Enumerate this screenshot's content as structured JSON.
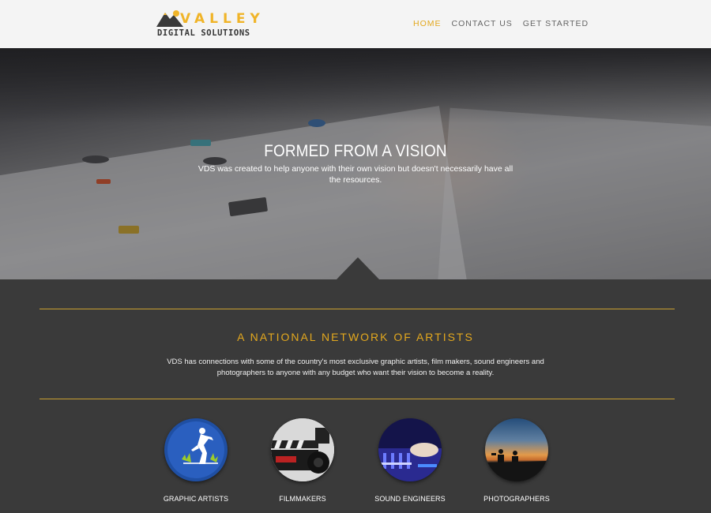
{
  "logo": {
    "top": "VALLEY",
    "bottom": "DIGITAL SOLUTIONS"
  },
  "nav": [
    {
      "label": "HOME",
      "active": true
    },
    {
      "label": "CONTACT US",
      "active": false
    },
    {
      "label": "GET STARTED",
      "active": false
    }
  ],
  "hero": {
    "title": "FORMED FROM A VISION",
    "subtitle": "VDS was created to help anyone with their own vision but doesn't necessarily have all the resources."
  },
  "network": {
    "title": "A NATIONAL NETWORK OF ARTISTS",
    "text": "VDS has connections with some of the country's most exclusive graphic artists, film makers, sound engineers and photographers to anyone with any budget who want their vision to become a reality."
  },
  "services": [
    {
      "label": "GRAPHIC ARTISTS",
      "icon": "graphic-artist-icon"
    },
    {
      "label": "FILMMAKERS",
      "icon": "clapperboard-icon"
    },
    {
      "label": "SOUND ENGINEERS",
      "icon": "mixing-console-icon"
    },
    {
      "label": "PHOTOGRAPHERS",
      "icon": "photographer-silhouette-icon"
    }
  ],
  "colors": {
    "accent": "#e3a81e",
    "dark": "#3a3a3a",
    "header": "#f4f4f4"
  }
}
